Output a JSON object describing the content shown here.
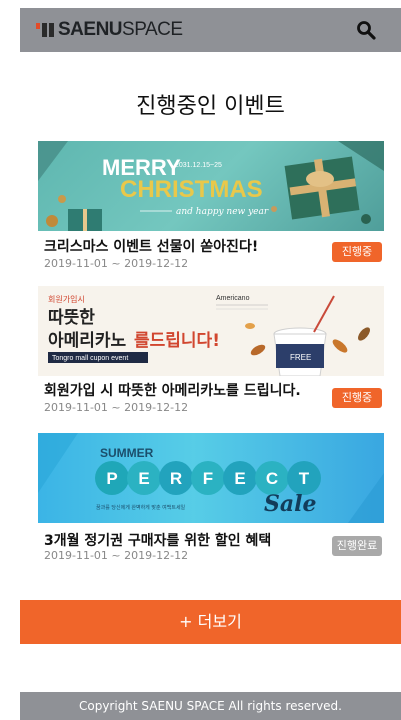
{
  "header": {
    "logo_bold": "SAENU",
    "logo_light": "SPACE",
    "search_icon": "search-icon"
  },
  "page_title": "진행중인 이벤트",
  "events": [
    {
      "title": "크리스마스 이벤트 선물이 쏟아진다!",
      "date": "2019-11-01 ~ 2019-12-12",
      "status": "진행중",
      "status_color": "#f0652a",
      "banner": {
        "line1": "MERRY",
        "date_small": "2031.12.15~25",
        "line2": "CHRISTMAS",
        "line3": "and happy new year"
      }
    },
    {
      "title": "회원가입 시 따뜻한 아메리카노를 드립니다.",
      "date": "2019-11-01 ~ 2019-12-12",
      "status": "진행중",
      "status_color": "#f0652a",
      "banner": {
        "small": "회원가입시",
        "line1": "따뜻한",
        "line2a": "아메리카노",
        "line2b": "를드립니다!",
        "caption": "Tongro mall cupon event",
        "label": "Americano",
        "cup_text": "FREE"
      }
    },
    {
      "title": "3개월 정기권 구매자를 위한 할인 혜택",
      "date": "2019-11-01 ~ 2019-12-12",
      "status": "진행완료",
      "status_color": "#a9a9a9",
      "banner": {
        "line1": "SUMMER",
        "letters": [
          "P",
          "E",
          "R",
          "F",
          "E",
          "C",
          "T"
        ],
        "sale": "Sale",
        "small": "꿈과를 당신에게 완벽하게 맞춘 여백트세일"
      }
    }
  ],
  "more_button": "+ 더보기",
  "footer": "Copyright SAENU SPACE All rights reserved."
}
